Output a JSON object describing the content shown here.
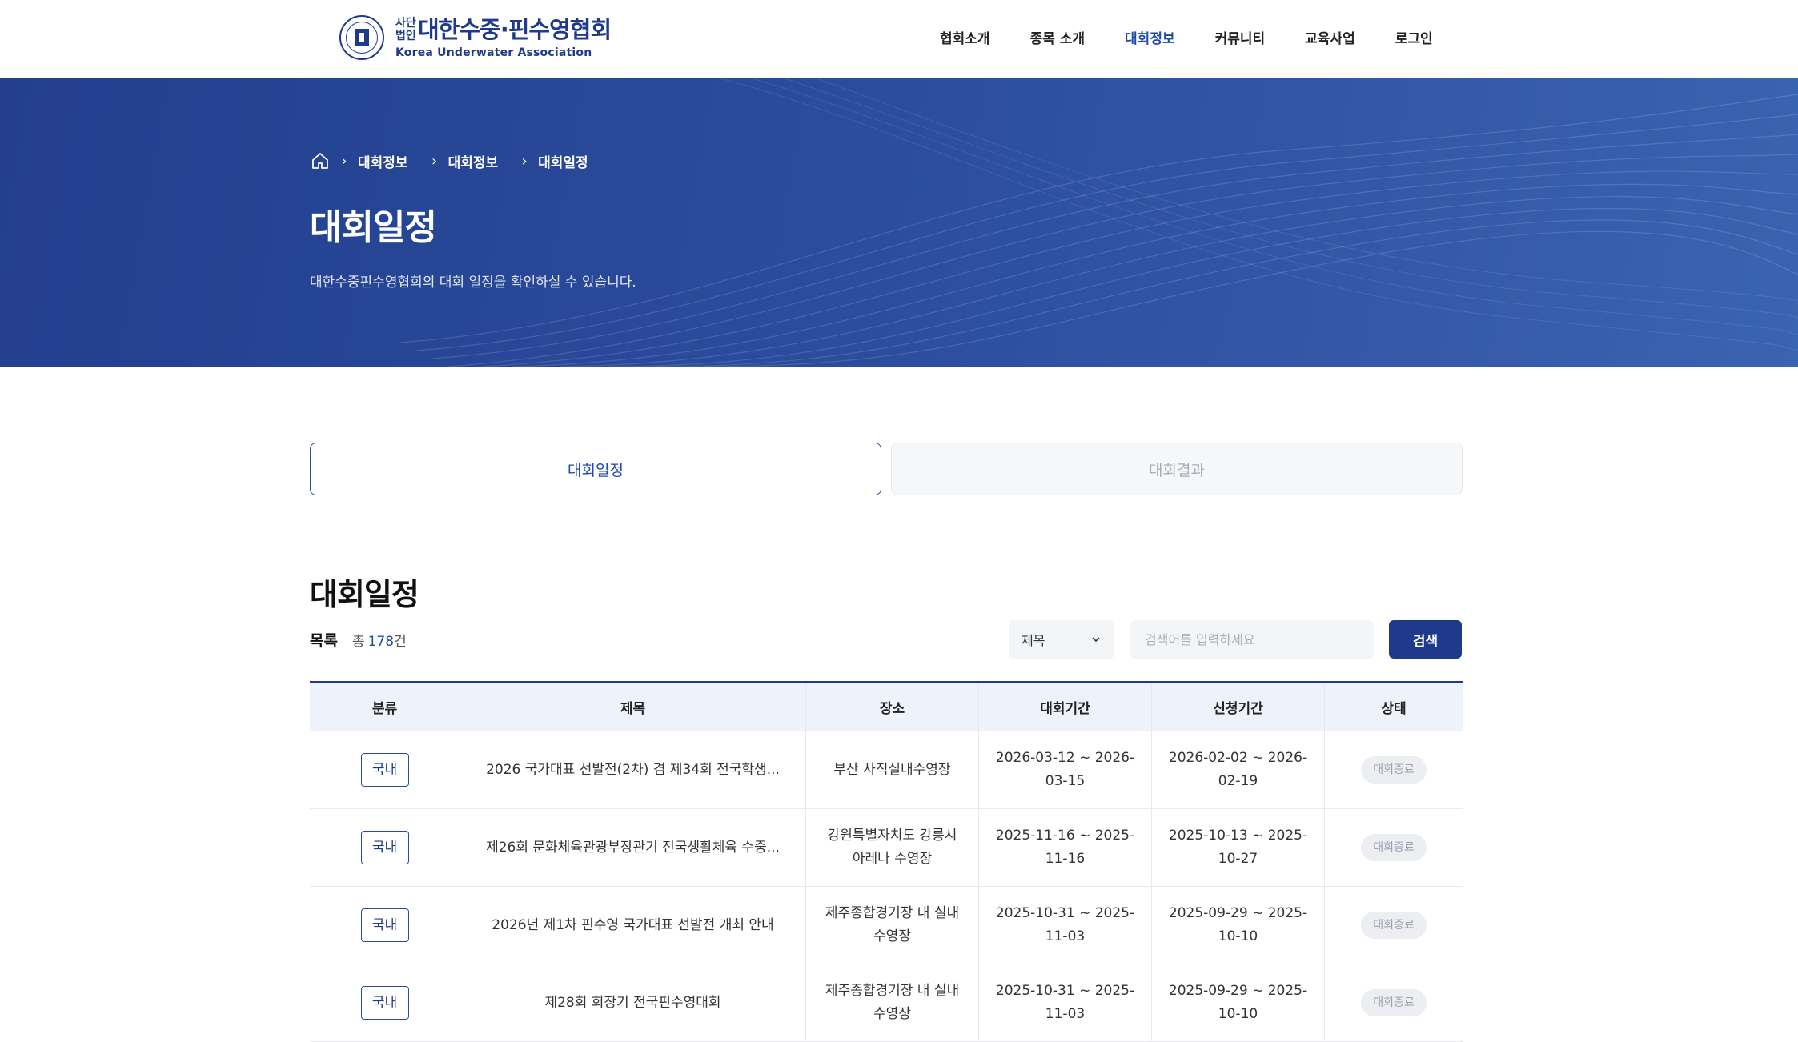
{
  "logo": {
    "small": "사단법인",
    "main": "대한수중·핀수영협회",
    "english": "Korea Underwater Association"
  },
  "nav": [
    {
      "label": "협회소개",
      "active": false
    },
    {
      "label": "종목 소개",
      "active": false
    },
    {
      "label": "대회정보",
      "active": true
    },
    {
      "label": "커뮤니티",
      "active": false
    },
    {
      "label": "교육사업",
      "active": false
    },
    {
      "label": "로그인",
      "active": false
    }
  ],
  "breadcrumb": [
    "대회정보",
    "대회정보",
    "대회일정"
  ],
  "hero": {
    "title": "대회일정",
    "description": "대한수중핀수영협회의 대회 일정을 확인하실 수 있습니다."
  },
  "tabs": [
    {
      "label": "대회일정",
      "active": true
    },
    {
      "label": "대회결과",
      "active": false
    }
  ],
  "section": {
    "title": "대회일정",
    "list_label": "목록",
    "count_prefix": "총",
    "count": "178",
    "count_suffix": "건"
  },
  "search": {
    "select_value": "제목",
    "placeholder": "검색어를 입력하세요",
    "button": "검색"
  },
  "table": {
    "headers": [
      "분류",
      "제목",
      "장소",
      "대회기간",
      "신청기간",
      "상태"
    ],
    "rows": [
      {
        "category": "국내",
        "title": "2026 국가대표 선발전(2차) 겸 제34회 전국학생...",
        "place": "부산 사직실내수영장",
        "period": "2026-03-12 ~ 2026-03-15",
        "apply": "2026-02-02 ~ 2026-02-19",
        "status": "대회종료"
      },
      {
        "category": "국내",
        "title": "제26회 문화체육관광부장관기 전국생활체육 수중...",
        "place": "강원특별자치도 강릉시 아레나 수영장",
        "period": "2025-11-16 ~ 2025-11-16",
        "apply": "2025-10-13 ~ 2025-10-27",
        "status": "대회종료"
      },
      {
        "category": "국내",
        "title": "2026년 제1차 핀수영 국가대표 선발전 개최 안내",
        "place": "제주종합경기장 내 실내 수영장",
        "period": "2025-10-31 ~ 2025-11-03",
        "apply": "2025-09-29 ~ 2025-10-10",
        "status": "대회종료"
      },
      {
        "category": "국내",
        "title": "제28회 회장기 전국핀수영대회",
        "place": "제주종합경기장 내 실내 수영장",
        "period": "2025-10-31 ~ 2025-11-03",
        "apply": "2025-09-29 ~ 2025-10-10",
        "status": "대회종료"
      }
    ]
  },
  "colors": {
    "brand": "#1f3a8a",
    "accent": "#1f4aa8",
    "hero": "#2b4b9c"
  }
}
